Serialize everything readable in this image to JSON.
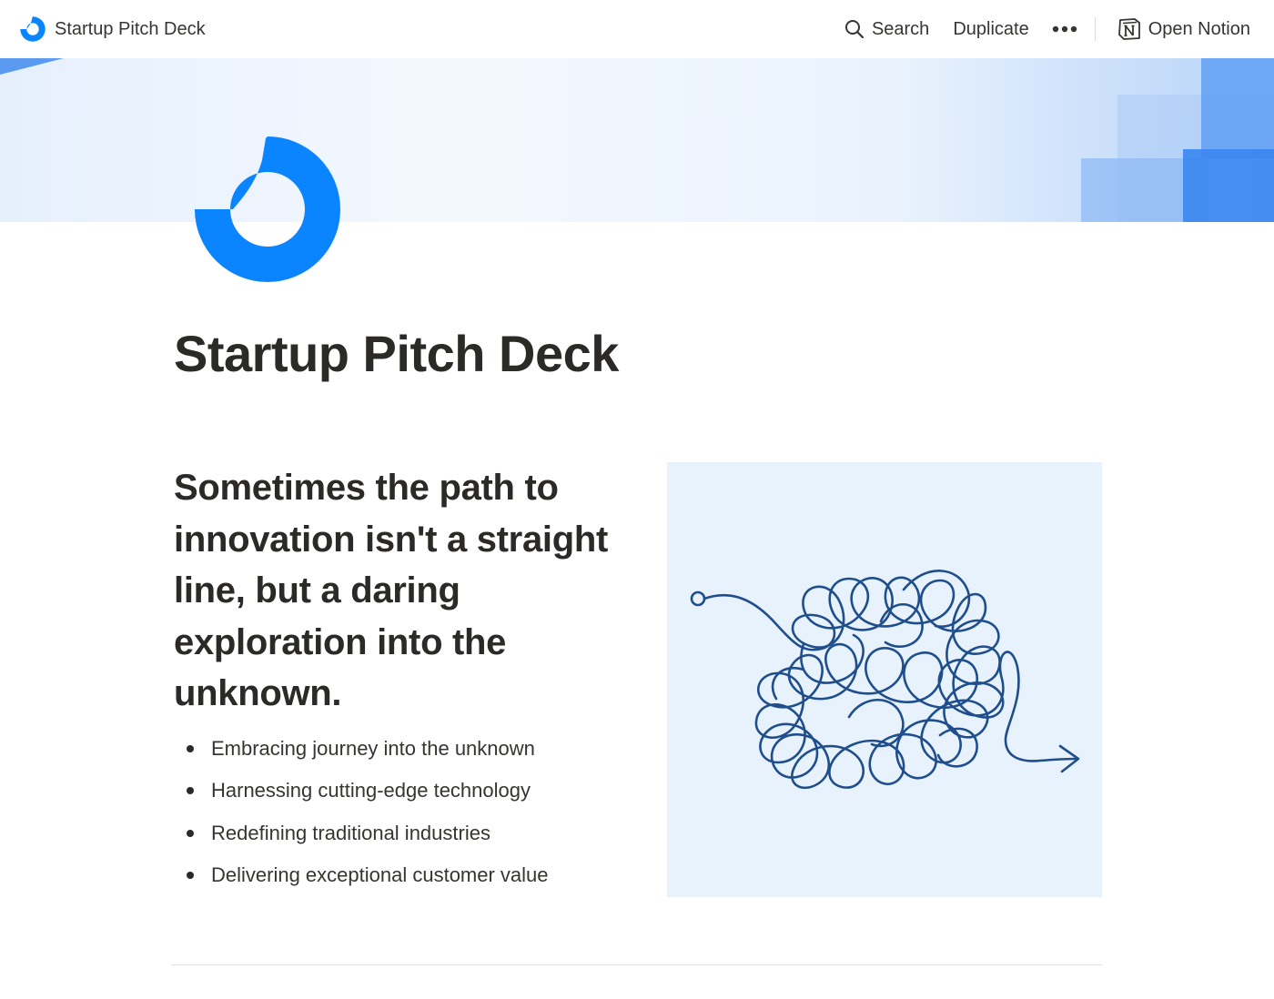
{
  "topbar": {
    "site_title": "Startup Pitch Deck",
    "logo_icon": "pitch-deck-logo-icon",
    "actions": {
      "search_label": "Search",
      "search_icon": "search-icon",
      "duplicate_label": "Duplicate",
      "more_icon": "more-dots-icon",
      "open_notion_label": "Open Notion",
      "notion_icon": "notion-logo-icon"
    }
  },
  "cover": {
    "style": "light blue gradient with translucent blue squares"
  },
  "page": {
    "icon": "pitch-deck-logo-icon",
    "title": "Startup Pitch Deck",
    "headline": "Sometimes the path to innovation isn't a straight line, but a daring exploration into the unknown.",
    "bullets": [
      "Embracing journey into the unknown",
      "Harnessing cutting-edge technology",
      "Redefining traditional industries",
      "Delivering exceptional customer value"
    ],
    "illustration": "tangled-path-arrow-illustration"
  },
  "colors": {
    "brand_blue": "#0a84ff",
    "text": "#37352f",
    "heading": "#2b2a26",
    "illustration_bg": "#e8f2fd",
    "scribble": "#1f4e8c"
  }
}
